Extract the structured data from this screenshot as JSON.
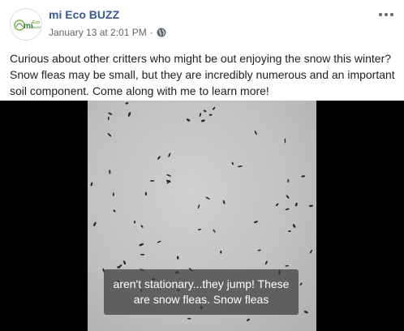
{
  "post": {
    "page_name": "mi Eco BUZZ",
    "date": "January 13 at 2:01 PM",
    "separator": "·",
    "privacy_icon": "globe-icon",
    "more_icon": "more-options-icon",
    "text": "Curious about other critters who might be out enjoying the snow this winter? Snow fleas may be small, but they are incredibly numerous and an important soil component. Come along with me to learn more!"
  },
  "avatar": {
    "logo_text_main": "mi",
    "logo_text_small_1": "Eco",
    "logo_text_small_2": "BUZZ",
    "colors": {
      "ring": "#7cb342",
      "text": "#2e7d32"
    }
  },
  "video": {
    "caption_line1": "aren't stationary...they jump! These",
    "caption_line2": "are snow fleas. Snow fleas"
  },
  "colors": {
    "link": "#385898",
    "meta": "#606770",
    "background": "#ffffff"
  }
}
